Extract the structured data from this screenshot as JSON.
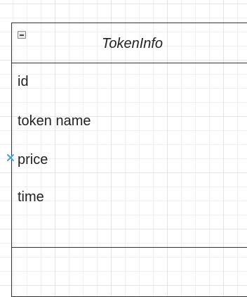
{
  "class": {
    "name": "TokenInfo",
    "attributes": [
      "id",
      "token name",
      "price",
      "time"
    ],
    "methods": []
  },
  "colors": {
    "border": "#333333",
    "connector": "#4aa3df"
  },
  "icons": {
    "collapse": "minus-box-icon",
    "connector": "x-connection-point-icon"
  }
}
